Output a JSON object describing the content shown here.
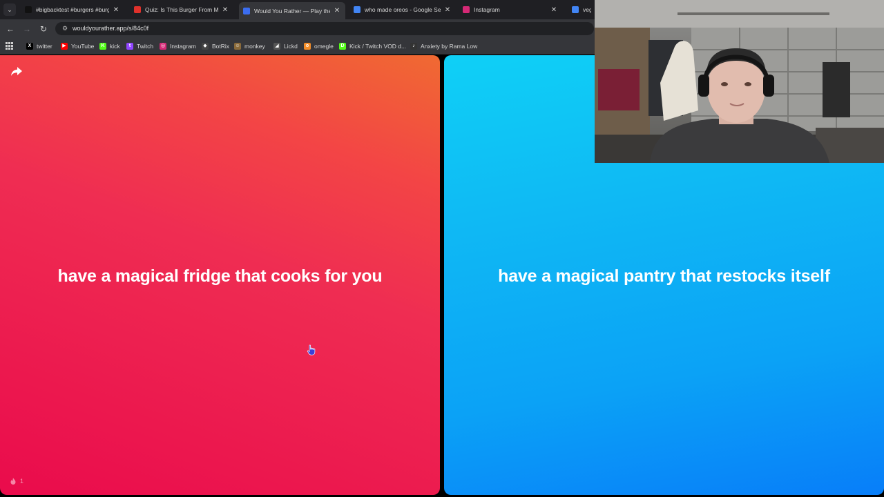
{
  "browser": {
    "tabs": [
      {
        "title": "#bigbacktest #burgers #burge",
        "favicon_color": "#111111",
        "active": false
      },
      {
        "title": "Quiz: Is This Burger From McD",
        "favicon_color": "#e0312b",
        "active": false
      },
      {
        "title": "Would You Rather — Play the C",
        "favicon_color": "#3b6df0",
        "active": true
      },
      {
        "title": "who made oreos - Google Sear",
        "favicon_color": "#4285f4",
        "active": false
      },
      {
        "title": "Instagram",
        "favicon_color": "#d62976",
        "active": false
      },
      {
        "title": "veget",
        "favicon_color": "#4285f4",
        "active": false
      }
    ],
    "address_bar": {
      "url": "wouldyourather.app/s/84c0f"
    },
    "bookmarks": [
      {
        "label": "twitter",
        "icon": "x-icon",
        "color": "#000000",
        "glyph": "X"
      },
      {
        "label": "YouTube",
        "icon": "youtube-icon",
        "color": "#ff0000",
        "glyph": "▶"
      },
      {
        "label": "kick",
        "icon": "kick-icon",
        "color": "#53fc18",
        "glyph": "K"
      },
      {
        "label": "Twitch",
        "icon": "twitch-icon",
        "color": "#9146ff",
        "glyph": "t"
      },
      {
        "label": "Instagram",
        "icon": "instagram-icon",
        "color": "#d62976",
        "glyph": "◎"
      },
      {
        "label": "BotRix",
        "icon": "botrix-icon",
        "color": "#444444",
        "glyph": "◆"
      },
      {
        "label": "monkey",
        "icon": "monkey-icon",
        "color": "#8a6a3a",
        "glyph": "☺"
      },
      {
        "label": "Lickd",
        "icon": "lickd-icon",
        "color": "#555555",
        "glyph": "◢"
      },
      {
        "label": "omegle",
        "icon": "omegle-icon",
        "color": "#f28c28",
        "glyph": "o"
      },
      {
        "label": "Kick / Twitch VOD d...",
        "icon": "download-icon",
        "color": "#53fc18",
        "glyph": "D"
      },
      {
        "label": "Anxiety by Rama Low",
        "icon": "music-icon",
        "color": "#333333",
        "glyph": "♪"
      }
    ]
  },
  "game": {
    "option_left": "have a magical fridge that cooks for you",
    "option_right": "have a magical pantry that restocks itself",
    "vote_count": "1",
    "colors": {
      "left_top": "#f06a32",
      "left_bottom": "#ea0b4c",
      "right_top": "#0fd0f6",
      "right_bottom": "#087ef9"
    }
  }
}
